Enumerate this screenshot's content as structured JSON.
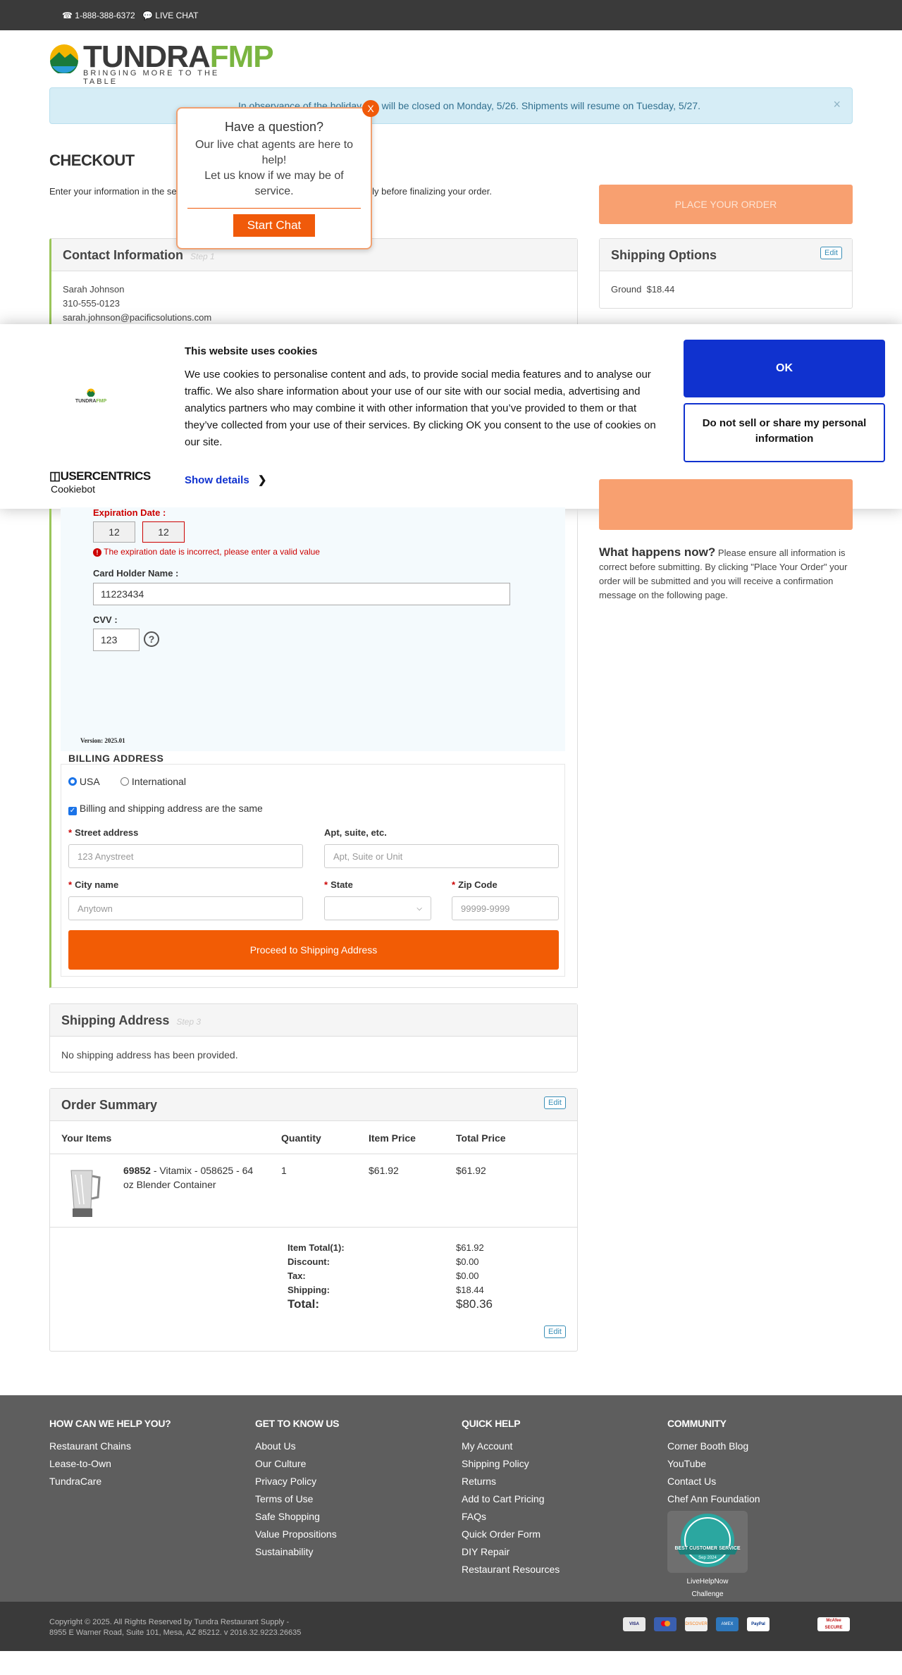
{
  "topbar": {
    "phone": "1-888-388-6372",
    "live_chat": "LIVE CHAT"
  },
  "logo": {
    "word1": "TUNDRA",
    "word2": "FMP",
    "tagline": "BRINGING MORE TO THE TABLE"
  },
  "alert": {
    "text": "In observance of the holiday, we will be closed on Monday, 5/26. Shipments will resume on Tuesday, 5/27.",
    "close": "×"
  },
  "page_title": "CHECKOUT",
  "intro": "Enter your information in the sections below and review your information carefully before finalizing your order.",
  "place_order": "PLACE YOUR ORDER",
  "chat_popup": {
    "title": "Have a question?",
    "line1": "Our live chat agents are here to help!",
    "line2": "Let us know if we may be of service.",
    "button": "Start Chat",
    "close": "X"
  },
  "contact": {
    "title": "Contact Information",
    "step": "Step 1",
    "name": "Sarah Johnson",
    "phone": "310-555-0123",
    "email": "sarah.johnson@pacificsolutions.com"
  },
  "shipping_options": {
    "title": "Shipping Options",
    "edit": "Edit",
    "value": "Ground  $18.44"
  },
  "cookie": {
    "title": "This website uses cookies",
    "body": "We use cookies to personalise content and ads, to provide social media features and to analyse our traffic. We also share information about your use of our site with our social media, advertising and analytics partners who may combine it with other information that you’ve provided to them or that they’ve collected from your use of their services. By clicking OK you consent to the use of cookies on our site.",
    "ok": "OK",
    "do_not_sell": "Do not sell or share my personal information",
    "show_details": "Show details",
    "brand": "USERCENTRICS",
    "brand_sub": "Cookiebot"
  },
  "payment": {
    "exp_label": "Expiration Date :",
    "exp_month": "12",
    "exp_year": "12",
    "exp_error": "The expiration date is incorrect, please enter a valid value",
    "holder_label": "Card Holder Name :",
    "holder_value": "11223434",
    "cvv_label": "CVV :",
    "cvv_value": "123",
    "cvv_help": "?",
    "version": "Version: 2025.01"
  },
  "billing": {
    "title": "BILLING ADDRESS",
    "radio_usa": "USA",
    "radio_intl": "International",
    "same_checkbox": "Billing and shipping address are the same",
    "street_label": "Street address",
    "street_placeholder": "123 Anystreet",
    "apt_label": "Apt, suite, etc.",
    "apt_placeholder": "Apt, Suite or Unit",
    "city_label": "City name",
    "city_placeholder": "Anytown",
    "state_label": "State",
    "zip_label": "Zip Code",
    "zip_placeholder": "99999-9999",
    "proceed": "Proceed to Shipping Address"
  },
  "side_what": {
    "title": "What happens now?",
    "text": "Please ensure all information is correct before submitting. By clicking \"Place Your Order\" your order will be submitted and you will receive a confirmation message on the following page."
  },
  "shipping_address": {
    "title": "Shipping Address",
    "step": "Step 3",
    "text": "No shipping address has been provided."
  },
  "summary": {
    "title": "Order Summary",
    "edit": "Edit",
    "headers": [
      "Your Items",
      "Quantity",
      "Item Price",
      "Total Price"
    ],
    "item": {
      "sku": "69852",
      "name": " - Vitamix - 058625 - 64 oz Blender Container",
      "qty": "1",
      "price": "$61.92",
      "total": "$61.92"
    },
    "totals": [
      {
        "label": "Item Total(1):",
        "value": "$61.92"
      },
      {
        "label": "Discount:",
        "value": "$0.00"
      },
      {
        "label": "Tax:",
        "value": "$0.00"
      },
      {
        "label": "Shipping:",
        "value": "$18.44"
      }
    ],
    "grand_label": "Total:",
    "grand_value": "$80.36"
  },
  "footer": {
    "cols": [
      {
        "title": "HOW CAN WE HELP YOU?",
        "items": [
          "Restaurant Chains",
          "Lease-to-Own",
          "TundraCare"
        ]
      },
      {
        "title": "GET TO KNOW US",
        "items": [
          "About Us",
          "Our Culture",
          "Privacy Policy",
          "Terms of Use",
          "Safe Shopping",
          "Value Propositions",
          "Sustainability"
        ]
      },
      {
        "title": "QUICK HELP",
        "items": [
          "My Account",
          "Shipping Policy",
          "Returns",
          "Add to Cart Pricing",
          "FAQs",
          "Quick Order Form",
          "DIY Repair",
          "Restaurant Resources"
        ]
      },
      {
        "title": "COMMUNITY",
        "items": [
          "Corner Booth Blog",
          "YouTube",
          "Contact Us",
          "Chef Ann Foundation"
        ]
      }
    ],
    "badge_caption1": "LiveHelpNow",
    "badge_caption2": "Challenge",
    "badge_text": "BEST CUSTOMER SERVICE",
    "badge_date": "Sep 2024",
    "copyright": "Copyright © 2025. All Rights Reserved by Tundra Restaurant Supply -",
    "address": "8955 E Warner Road, Suite 101, Mesa, AZ 85212. v 2016.32.9223.26635",
    "cards": [
      "VISA",
      "MC",
      "DISCOVER",
      "AMEX",
      "PayPal"
    ],
    "secure": "McAfee SECURE"
  }
}
